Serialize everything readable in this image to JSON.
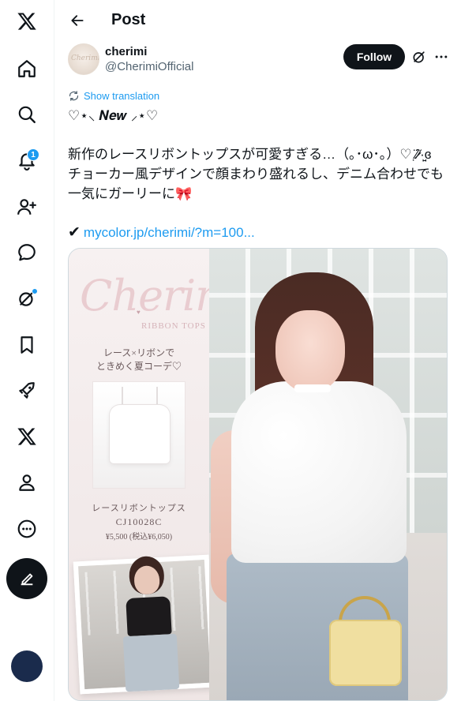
{
  "sidebar": {
    "notifications_badge": "1"
  },
  "header": {
    "title": "Post"
  },
  "author": {
    "name": "cherimi",
    "handle": "@CherimiOfficial",
    "avatar_text": "Cherimi",
    "follow_label": "Follow"
  },
  "post": {
    "translate_label": "Show translation",
    "line1": "♡⋆⸜ 𝑵𝒆𝒘 ⸝⋆♡",
    "line2": "新作のレースリボントップスが可愛すぎる…（｡･ω･｡）♡ ̈⁄̷̣̑⁄·̤̮ɞ",
    "line3": "チョーカー風デザインで顔まわり盛れるし、デニム合わせでも",
    "line4_text": "一気にガーリーに",
    "line4_emoji": "🎀",
    "link_check": "✔",
    "link_text": "mycolor.jp/cherimi/?m=100..."
  },
  "media": {
    "brand_script": "Cherimi",
    "brand_sub": "RIBBON TOPS",
    "promo_line1": "レース×リボンで",
    "promo_line2": "ときめく夏コーデ♡",
    "product_name": "レースリボントップス",
    "product_code": "CJ10028C",
    "product_price": "¥5,500 (税込¥6,050)"
  },
  "colors": {
    "accent": "#1d9bf0",
    "text": "#0f1419",
    "muted": "#536471",
    "follow_bg": "#0f1419"
  },
  "icons": [
    "x-logo-icon",
    "home-icon",
    "search-icon",
    "bell-icon",
    "person-plus-icon",
    "chat-bubble-icon",
    "grok-icon",
    "bookmark-icon",
    "rocket-icon",
    "x-premium-icon",
    "profile-icon",
    "more-circle-icon",
    "compose-icon",
    "back-arrow-icon",
    "translate-icon",
    "more-dots-icon"
  ]
}
